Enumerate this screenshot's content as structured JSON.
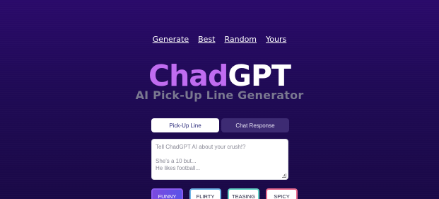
{
  "nav": {
    "items": [
      "Generate",
      "Best",
      "Random",
      "Yours"
    ]
  },
  "logo": {
    "part1": "Chad",
    "part2": "GPT"
  },
  "subtitle": "AI Pick-Up Line Generator",
  "mode_tabs": {
    "active": "Pick-Up Line",
    "inactive": "Chat Response"
  },
  "prompt": {
    "line1": "Tell ChadGPT AI about your crush!?",
    "line2": "She's a 10 but...",
    "line3": "He likes football..."
  },
  "styles": {
    "funny": "FUNNY",
    "flirty": "FLIRTY",
    "teasing": "TEASING",
    "spicy": "SPICY"
  },
  "colors": {
    "background_top": "#2a0a6a",
    "background_bottom": "#1a0947",
    "logo_accent": "#c06cf0",
    "tab_inactive": "#3d2b73",
    "funny_gradient": "#7b4ae0",
    "flirty_border": "#6fb4e6",
    "teasing_border": "#63d2c6",
    "spicy_border": "#e86a8e"
  }
}
